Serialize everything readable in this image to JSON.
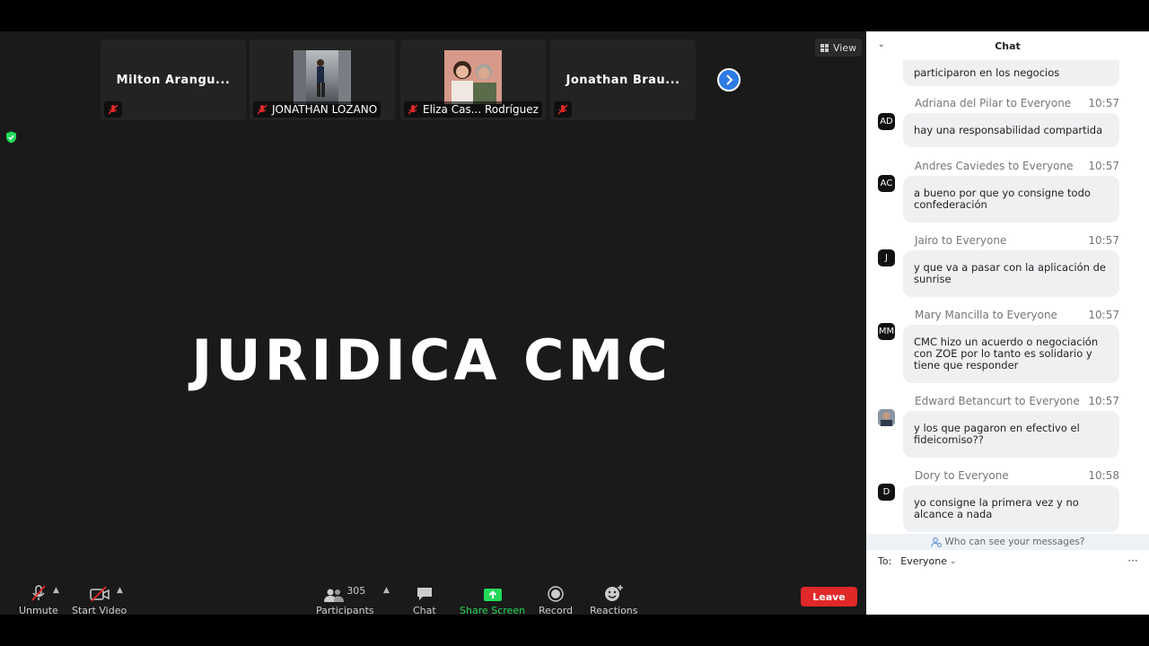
{
  "meeting": {
    "title": "JURIDICA CMC",
    "view_label": "View",
    "participants_thumbs": [
      {
        "name": "Milton Arangu...",
        "muted": true
      },
      {
        "name": "JONATHAN LOZANO",
        "muted": true
      },
      {
        "name": "Eliza Cas... Rodríguez",
        "muted": true
      },
      {
        "name": "Jonathan Brau...",
        "muted": true
      }
    ]
  },
  "toolbar": {
    "unmute": "Unmute",
    "start_video": "Start Video",
    "participants": "Participants",
    "participants_count": "305",
    "chat": "Chat",
    "share_screen": "Share Screen",
    "record": "Record",
    "reactions": "Reactions",
    "leave": "Leave"
  },
  "chat": {
    "title": "Chat",
    "truncated_top": "participaron en los negocios",
    "messages": [
      {
        "sender": "Adriana del Pilar to Everyone",
        "time": "10:57",
        "avatar": "AD",
        "lines": [
          "hay una responsabilidad compartida"
        ]
      },
      {
        "sender": "Andres Caviedes to Everyone",
        "time": "10:57",
        "avatar": "AC",
        "lines": [
          "a bueno por que yo consigne todo",
          "confederación"
        ]
      },
      {
        "sender": "Jairo to Everyone",
        "time": "10:57",
        "avatar": "J",
        "lines": [
          "y que va a pasar con la aplicación de",
          "sunrise"
        ]
      },
      {
        "sender": "Mary Mancilla to Everyone",
        "time": "10:57",
        "avatar": "MM",
        "lines": [
          "CMC hizo un acuerdo o negociación",
          "con ZOE por lo tanto es solidario y",
          "tiene que responder"
        ]
      },
      {
        "sender": "Edward Betancurt to Everyone",
        "time": "10:57",
        "avatar": "",
        "lines": [
          "y los que pagaron en efectivo el",
          "fideicomiso??"
        ]
      },
      {
        "sender": "Dory to Everyone",
        "time": "10:58",
        "avatar": "D",
        "lines": [
          "yo consigne la primera vez y no",
          "alcance a nada"
        ]
      }
    ],
    "who_can_see": "Who can see your messages?",
    "to_label": "To:",
    "to_value": "Everyone",
    "more": "···"
  },
  "colors": {
    "leave": "#e02828",
    "share_screen": "#23d959",
    "next_button": "#2c7be5",
    "shield": "#23d959"
  }
}
